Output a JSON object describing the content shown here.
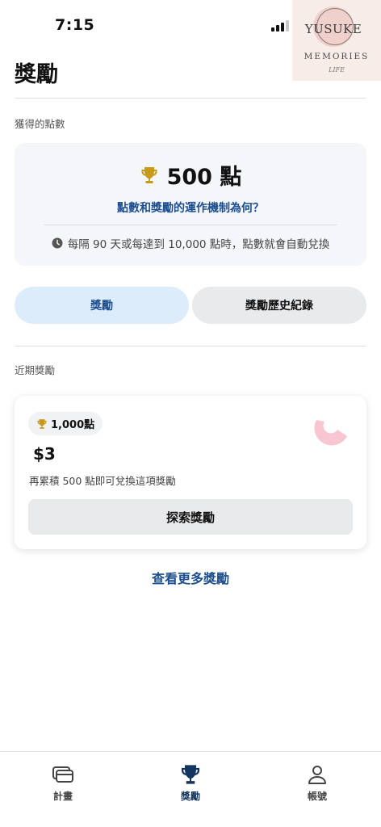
{
  "status_bar": {
    "time": "7:15"
  },
  "watermark": {
    "name": "YUSUKE",
    "sub": "MEMORIES",
    "mark": "LIFE"
  },
  "page": {
    "title": "獎勵"
  },
  "points_section": {
    "label": "獲得的點數",
    "points": "500 點",
    "how_it_works": "點數和獎勵的運作機制為何？",
    "redeem_note": "每隔 90 天或每達到 10,000 點時，點數就會自動兌換"
  },
  "tabs": [
    {
      "label": "獎勵",
      "active": true
    },
    {
      "label": "獎勵歷史紀錄",
      "active": false
    }
  ],
  "recent_section": {
    "label": "近期獎勵",
    "reward": {
      "cost_badge": "1,000點",
      "amount": "$3",
      "description": "再累積 500 點即可兌換這項獎勵",
      "button_label": "探索獎勵"
    }
  },
  "view_more": "查看更多獎勵",
  "bottom_nav": [
    {
      "label": "計畫",
      "icon": "cards-icon",
      "active": false
    },
    {
      "label": "獎勵",
      "icon": "trophy-icon",
      "active": true
    },
    {
      "label": "帳號",
      "icon": "person-icon",
      "active": false
    }
  ],
  "colors": {
    "accent": "#1d4e8f",
    "trophy_gold": "#c99a1a",
    "active_tab_bg": "#ddecfb",
    "card_bg": "#f4f6f9",
    "pink_decoration": "#f7c6d0"
  }
}
